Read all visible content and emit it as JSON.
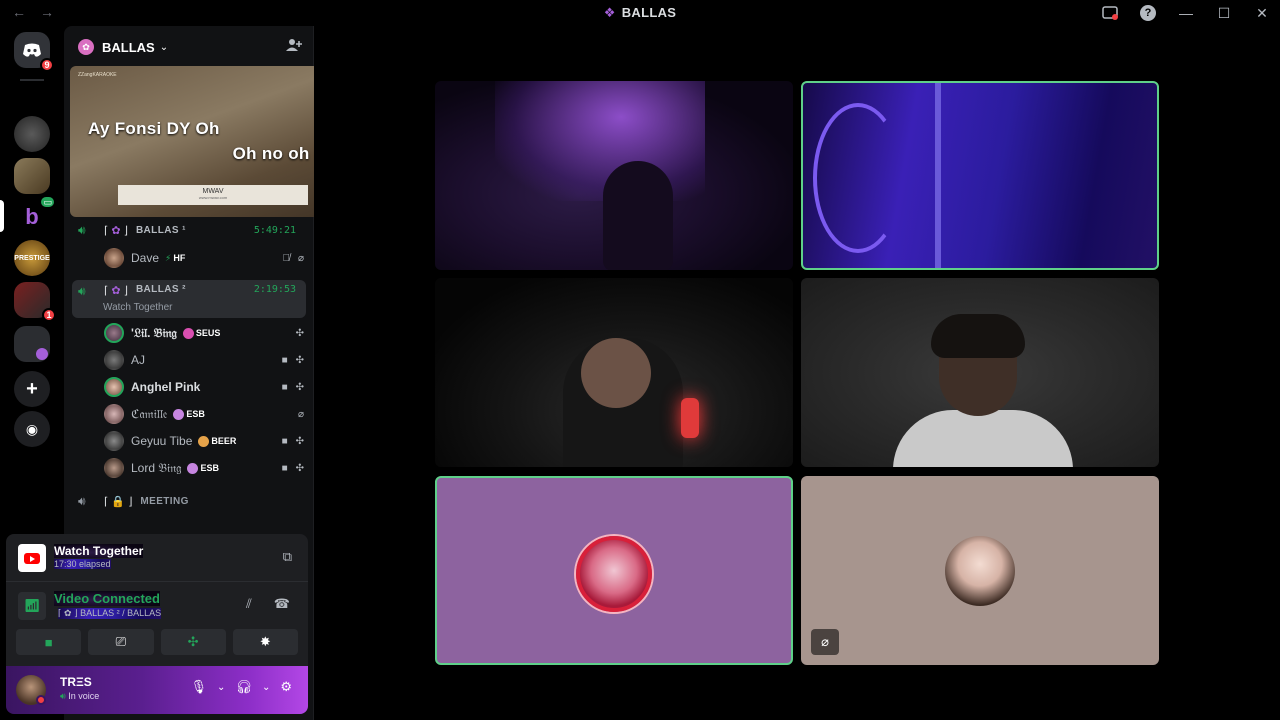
{
  "window": {
    "title": "BALLAS",
    "back_icon": "←",
    "forward_icon": "→",
    "minimize": "—",
    "maximize": "☐",
    "close": "✕",
    "help": "?"
  },
  "rail": {
    "home_badge": "9",
    "server_badge": "1",
    "prestige_label": "PRESTIGE"
  },
  "guild": {
    "name": "BALLAS",
    "chevron": "⌄"
  },
  "activity": {
    "watermark": "ZZangKARAOKE",
    "line1": "Ay Fonsi DY Oh",
    "line2": "Oh no oh no",
    "strip_title": "MWAV",
    "strip_url": "www.mwav.com",
    "logo_text": "ZZ"
  },
  "channels": [
    {
      "bracket_left": "⌈",
      "bracket_right": "⌋",
      "glyph": "✿",
      "name": "BALLAS ¹",
      "time": "5:49:21"
    },
    {
      "bracket_left": "⌈",
      "bracket_right": "⌋",
      "glyph": "✿",
      "name": "BALLAS ²",
      "time": "2:19:53",
      "sub": "Watch Together"
    },
    {
      "bracket_left": "⌈",
      "bracket_right": "⌋",
      "glyph": "🔒",
      "name": "MEETING"
    }
  ],
  "members_ch1": [
    {
      "name": "Dave",
      "tag": "HF"
    }
  ],
  "members_ch2": [
    {
      "name": "'𝔏𝔦𝔩. 𝔅𝔦𝔫𝔤",
      "tag": "SEUS"
    },
    {
      "name": "AJ",
      "tag": ""
    },
    {
      "name": "Anghel Pink",
      "tag": ""
    },
    {
      "name": "ℭ𝔞𝔪𝔦𝔩𝔩𝔢",
      "tag": "ESB"
    },
    {
      "name": "Geyuu Tibe",
      "tag": "BEER"
    },
    {
      "name": "Lord 𝔅𝔦𝔫𝔤",
      "tag": "ESB"
    }
  ],
  "watch_together": {
    "title": "Watch Together",
    "elapsed": "17:30 elapsed"
  },
  "voice": {
    "status": "Video Connected",
    "location": "⌈ ✿ ⌋ BALLAS ² / BALLAS"
  },
  "user": {
    "name": "TRΞS",
    "status": "In voice"
  },
  "colors": {
    "green": "#23a55a",
    "speaking_border": "#5fd089",
    "danger": "#f23f43",
    "accent": "#a45fd9"
  }
}
